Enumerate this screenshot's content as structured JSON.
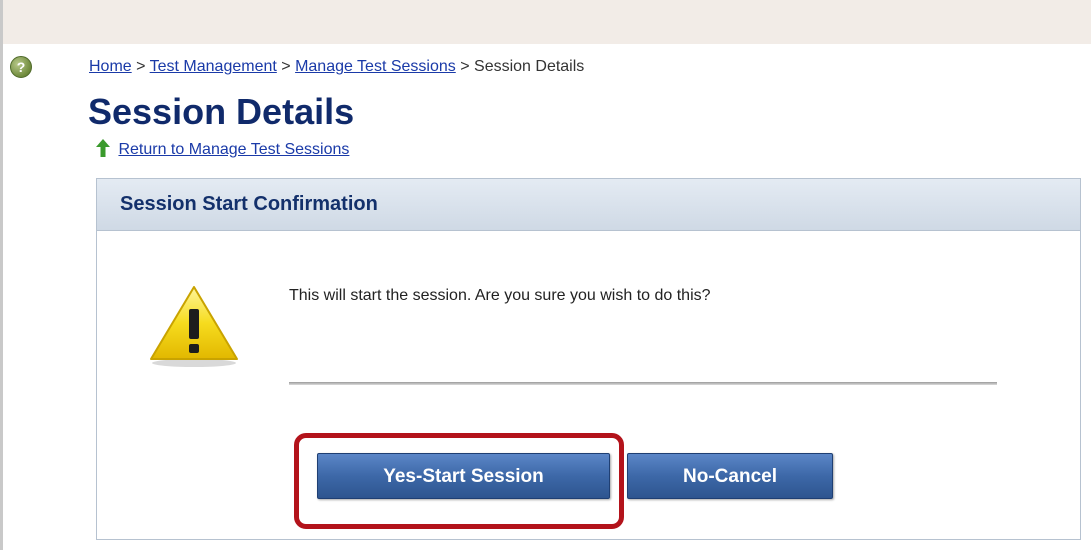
{
  "breadcrumb": {
    "home": "Home",
    "sep1": ">",
    "test_management": "Test Management",
    "sep2": ">",
    "manage_sessions": "Manage Test Sessions",
    "sep3": ">",
    "current": "Session Details"
  },
  "page": {
    "title": "Session Details",
    "return_link": "Return to Manage Test Sessions"
  },
  "dialog": {
    "title": "Session Start Confirmation",
    "message": "This will start the session. Are you sure you wish to do this?",
    "yes_label": "Yes-Start Session",
    "cancel_label": "No-Cancel"
  },
  "icons": {
    "help": "help-icon",
    "warning": "warning-icon",
    "up_arrow": "up-arrow-icon"
  },
  "colors": {
    "title_blue": "#102a6b",
    "link_blue": "#1a3aa8",
    "button_blue": "#3d68a8",
    "highlight_red": "#b3131b",
    "warning_yellow": "#f3d300"
  }
}
